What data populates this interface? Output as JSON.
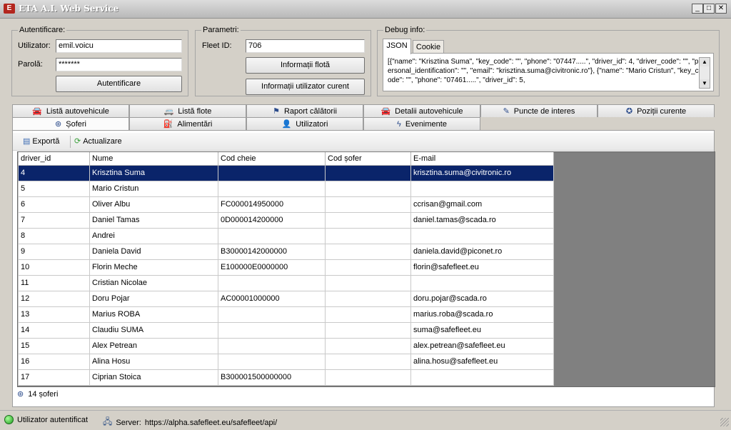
{
  "window": {
    "title": "ETA A.I. Web Service",
    "icon_label": "E",
    "minimize": "_",
    "maximize": "□",
    "close": "✕"
  },
  "auth": {
    "legend": "Autentificare:",
    "user_label": "Utilizator:",
    "user_value": "emil.voicu",
    "pass_label": "Parolă:",
    "pass_value": "*******",
    "login_button": "Autentificare"
  },
  "params": {
    "legend": "Parametri:",
    "fleet_label": "Fleet ID:",
    "fleet_value": "706",
    "fleet_info_button": "Informații flotă",
    "user_info_button": "Informații utilizator curent"
  },
  "debug": {
    "legend": "Debug info:",
    "tabs": [
      "JSON",
      "Cookie"
    ],
    "active_tab": "JSON",
    "text": "[{\"name\": \"Krisztina Suma\", \"key_code\": \"\", \"phone\": \"07447.....\", \"driver_id\": 4, \"driver_code\": \"\", \"personal_identification\": \"\", \"email\": \"krisztina.suma@civitronic.ro\"}, {\"name\": \"Mario Cristun\", \"key_code\": \"\", \"phone\": \"07461.....\", \"driver_id\": 5,"
  },
  "tabs_row1": [
    {
      "label": "Listă autovehicule",
      "icon": "car-icon"
    },
    {
      "label": "Listă flote",
      "icon": "fleet-icon"
    },
    {
      "label": "Raport călătorii",
      "icon": "report-icon"
    },
    {
      "label": "Detalii autovehicule",
      "icon": "car-icon"
    },
    {
      "label": "Puncte de interes",
      "icon": "poi-icon"
    },
    {
      "label": "Poziții curente",
      "icon": "globe-icon"
    }
  ],
  "tabs_row2": [
    {
      "label": "Șoferi",
      "icon": "steering-wheel-icon"
    },
    {
      "label": "Alimentări",
      "icon": "fuel-icon"
    },
    {
      "label": "Utilizatori",
      "icon": "user-icon"
    },
    {
      "label": "Evenimente",
      "icon": "lightning-icon"
    }
  ],
  "active_tab": "Șoferi",
  "toolbar": {
    "export_label": "Exportă",
    "refresh_label": "Actualizare"
  },
  "grid": {
    "columns": [
      "driver_id",
      "Nume",
      "Cod cheie",
      "Cod șofer",
      "E-mail"
    ],
    "selected_row": 0,
    "rows": [
      [
        "4",
        "Krisztina Suma",
        "",
        "",
        "krisztina.suma@civitronic.ro"
      ],
      [
        "5",
        "Mario Cristun",
        "",
        "",
        ""
      ],
      [
        "6",
        "Oliver Albu",
        "FC000014950000",
        "",
        "ccrisan@gmail.com"
      ],
      [
        "7",
        "Daniel Tamas",
        "0D000014200000",
        "",
        "daniel.tamas@scada.ro"
      ],
      [
        "8",
        "Andrei",
        "",
        "",
        ""
      ],
      [
        "9",
        "Daniela David",
        "B30000142000000",
        "",
        "daniela.david@piconet.ro"
      ],
      [
        "10",
        "Florin Meche",
        "E100000E0000000",
        "",
        "florin@safefleet.eu"
      ],
      [
        "11",
        "Cristian Nicolae",
        "",
        "",
        ""
      ],
      [
        "12",
        "Doru Pojar",
        "AC00001000000",
        "",
        "doru.pojar@scada.ro"
      ],
      [
        "13",
        "Marius ROBA",
        "",
        "",
        "marius.roba@scada.ro"
      ],
      [
        "14",
        "Claudiu SUMA",
        "",
        "",
        "suma@safefleet.eu"
      ],
      [
        "15",
        "Alex Petrean",
        "",
        "",
        "alex.petrean@safefleet.eu"
      ],
      [
        "16",
        "Alina Hosu",
        "",
        "",
        "alina.hosu@safefleet.eu"
      ],
      [
        "17",
        "Ciprian Stoica",
        "B300001500000000",
        "",
        ""
      ]
    ]
  },
  "footer_count": "14 șoferi",
  "status": {
    "auth_status": "Utilizator autentificat",
    "server_label": "Server:",
    "server_url": "https://alpha.safefleet.eu/safefleet/api/"
  }
}
